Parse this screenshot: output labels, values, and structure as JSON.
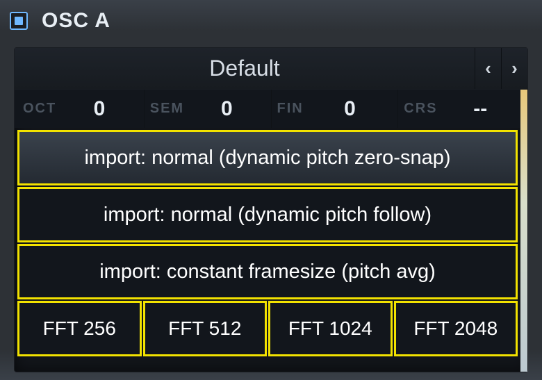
{
  "header": {
    "title": "OSC  A"
  },
  "preset": {
    "name": "Default",
    "prev_glyph": "‹",
    "next_glyph": "›"
  },
  "tune": {
    "oct": {
      "label": "OCT",
      "value": "0"
    },
    "sem": {
      "label": "SEM",
      "value": "0"
    },
    "fin": {
      "label": "FIN",
      "value": "0"
    },
    "crs": {
      "label": "CRS",
      "value": "--"
    }
  },
  "menu": {
    "items": [
      "import: normal (dynamic pitch zero-snap)",
      "import: normal (dynamic pitch follow)",
      "import: constant framesize (pitch avg)"
    ],
    "fft": [
      "FFT 256",
      "FFT 512",
      "FFT 1024",
      "FFT 2048"
    ]
  },
  "colors": {
    "highlight": "#f2e200",
    "accent": "#6fb8ff"
  }
}
